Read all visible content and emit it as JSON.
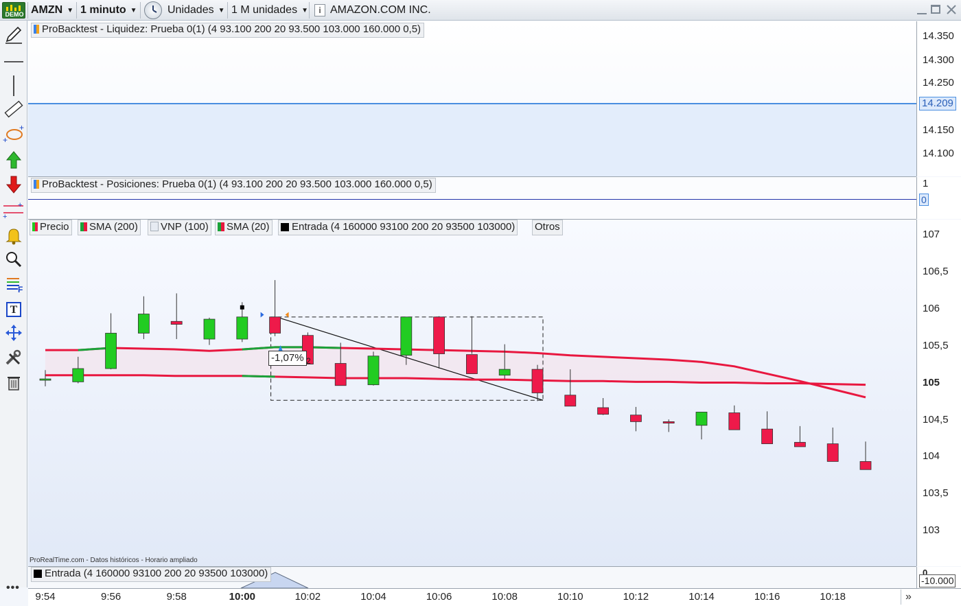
{
  "toolbar": {
    "demo_badge": "DEMO",
    "symbol": "AMZN",
    "timeframe": "1 minuto",
    "units": "Unidades",
    "count": "1 M unidades",
    "instrument_name": "AMAZON.COM INC."
  },
  "liquidity_panel": {
    "label": "ProBacktest - Liquidez: Prueba 0(1) (4 93.100 200 20 93.500 103.000 160.000 0,5)",
    "ticks": [
      "14.350",
      "14.300",
      "14.250",
      "14.150",
      "14.100"
    ],
    "current_value": "14.209"
  },
  "positions_panel": {
    "label": "ProBacktest - Posiciones: Prueba 0(1) (4 93.100 200 20 93.500 103.000 160.000 0,5)",
    "ticks": [
      "1"
    ],
    "current_value": "0"
  },
  "price_panel": {
    "legend": [
      "Precio",
      "SMA (200)",
      "VNP (100)",
      "SMA (20)",
      "Entrada (4 160000 93100 200 20 93500 103000)",
      "Otros"
    ],
    "ticks": [
      "107",
      "106,5",
      "106",
      "105,5",
      "105",
      "104,5",
      "104",
      "103,5",
      "103"
    ],
    "measure_label": "-1,07%",
    "measure_bars": "2",
    "footer_note": "ProRealTime.com - Datos históricos - Horario ampliado"
  },
  "entrada_panel": {
    "label": "Entrada (4 160000 93100 200 20 93500 103000)",
    "ticks": [
      "0"
    ],
    "current_value": "-10.000"
  },
  "x_axis": {
    "labels": [
      "9:54",
      "9:56",
      "9:58",
      "10:00",
      "10:02",
      "10:04",
      "10:06",
      "10:08",
      "10:10",
      "10:12",
      "10:14",
      "10:16",
      "10:18"
    ]
  },
  "colors": {
    "bull": "#22cc22",
    "bear": "#ee1a4a",
    "sma": "#e8173f",
    "sma_green": "#1aa33a",
    "liquidity_line": "#4a8ee0",
    "positions_line": "#2233aa"
  },
  "chart_data": {
    "type": "candlestick",
    "x": [
      "9:54",
      "9:55",
      "9:56",
      "9:57",
      "9:58",
      "9:59",
      "10:00",
      "10:01",
      "10:02",
      "10:03",
      "10:04",
      "10:05",
      "10:06",
      "10:07",
      "10:08",
      "10:09",
      "10:10",
      "10:11",
      "10:12",
      "10:13",
      "10:14",
      "10:15",
      "10:16",
      "10:17",
      "10:18",
      "10:19"
    ],
    "open": [
      105.09,
      105.05,
      105.23,
      105.71,
      105.87,
      105.63,
      105.63,
      105.93,
      105.68,
      105.3,
      105.01,
      105.41,
      105.93,
      105.42,
      105.14,
      105.22,
      104.87,
      104.7,
      104.6,
      104.51,
      104.46,
      104.63,
      104.41,
      104.23,
      104.21,
      103.97
    ],
    "high": [
      105.21,
      105.39,
      105.98,
      106.21,
      106.25,
      105.92,
      106.13,
      106.43,
      105.72,
      105.58,
      105.46,
      105.55,
      105.94,
      105.94,
      105.56,
      105.28,
      105.22,
      104.83,
      104.71,
      104.54,
      104.54,
      104.73,
      104.65,
      104.45,
      104.43,
      104.24
    ],
    "low": [
      104.99,
      105.03,
      105.22,
      105.63,
      105.63,
      105.55,
      105.59,
      105.67,
      105.29,
      105.02,
      105.0,
      105.28,
      105.23,
      105.43,
      105.09,
      104.79,
      104.81,
      104.6,
      104.38,
      104.37,
      104.27,
      104.42,
      104.31,
      104.19,
      104.17,
      103.93
    ],
    "close": [
      105.09,
      105.23,
      105.71,
      105.97,
      105.83,
      105.9,
      105.93,
      105.71,
      105.29,
      105.0,
      105.4,
      105.93,
      105.43,
      105.16,
      105.22,
      104.9,
      104.72,
      104.61,
      104.51,
      104.49,
      104.64,
      104.4,
      104.21,
      104.17,
      103.97,
      103.86
    ],
    "series": [
      {
        "name": "SMA (200)",
        "x": [
          "9:54",
          "9:55",
          "9:56",
          "9:57",
          "9:58",
          "9:59",
          "10:00",
          "10:01",
          "10:02",
          "10:03",
          "10:04",
          "10:05",
          "10:06",
          "10:07",
          "10:08",
          "10:09",
          "10:10",
          "10:11",
          "10:12",
          "10:13",
          "10:14",
          "10:15",
          "10:16",
          "10:17",
          "10:18",
          "10:19"
        ],
        "values": [
          105.48,
          105.48,
          105.51,
          105.5,
          105.49,
          105.47,
          105.49,
          105.52,
          105.52,
          105.51,
          105.5,
          105.49,
          105.48,
          105.47,
          105.46,
          105.44,
          105.41,
          105.39,
          105.37,
          105.35,
          105.32,
          105.26,
          105.16,
          105.06,
          104.95,
          104.84
        ]
      },
      {
        "name": "SMA (20)",
        "x": [
          "9:54",
          "9:55",
          "9:56",
          "9:57",
          "9:58",
          "9:59",
          "10:00",
          "10:01",
          "10:02",
          "10:03",
          "10:04",
          "10:05",
          "10:06",
          "10:07",
          "10:08",
          "10:09",
          "10:10",
          "10:11",
          "10:12",
          "10:13",
          "10:14",
          "10:15",
          "10:16",
          "10:17",
          "10:18",
          "10:19"
        ],
        "values": [
          105.14,
          105.14,
          105.14,
          105.14,
          105.13,
          105.13,
          105.13,
          105.12,
          105.11,
          105.1,
          105.1,
          105.1,
          105.09,
          105.08,
          105.08,
          105.07,
          105.06,
          105.06,
          105.05,
          105.05,
          105.04,
          105.04,
          105.03,
          105.03,
          105.02,
          105.01
        ]
      }
    ],
    "ylim": [
      102.55,
      107.25
    ],
    "liquidity_ylim": [
      14.05,
      14.375
    ],
    "liquidity_value": 14.209,
    "positions_value": 0,
    "measure": {
      "from_x": "10:01",
      "to_x": "10:09",
      "from_y": 105.93,
      "to_y": 104.8,
      "change": "-1,07%"
    }
  }
}
